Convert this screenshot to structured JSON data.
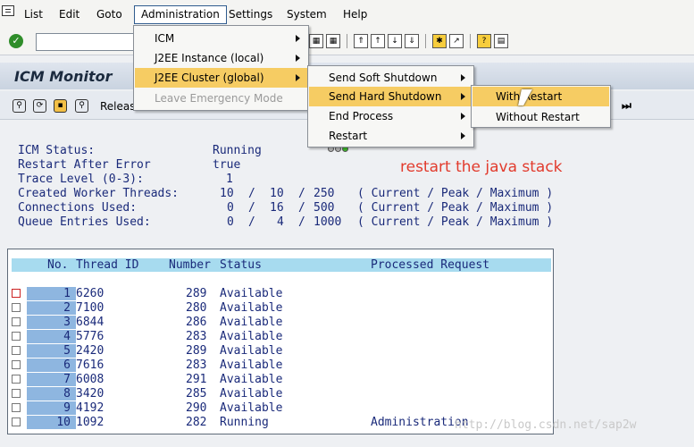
{
  "menubar": {
    "items": [
      "List",
      "Edit",
      "Goto",
      "Administration",
      "Settings",
      "System",
      "Help"
    ]
  },
  "title": "ICM Monitor",
  "apptoolbar": {
    "release_label": "Releas"
  },
  "info": {
    "icm_status": {
      "label": "ICM Status:",
      "value": "Running"
    },
    "restart_after_error": {
      "label": "Restart After Error",
      "value": "true"
    },
    "trace_level": {
      "label": "Trace Level (0-3):",
      "value": "1"
    },
    "created_worker_threads": {
      "label": "Created Worker Threads:",
      "current": "10",
      "peak": "10",
      "maximum": "250",
      "legend": "( Current / Peak / Maximum )"
    },
    "connections_used": {
      "label": "Connections Used:",
      "current": "0",
      "peak": "16",
      "maximum": "500",
      "legend": "( Current / Peak / Maximum )"
    },
    "queue_entries_used": {
      "label": "Queue Entries Used:",
      "current": "0",
      "peak": "4",
      "maximum": "1000",
      "legend": "( Current / Peak / Maximum )"
    }
  },
  "annotation": "restart the java stack",
  "table": {
    "columns": [
      "No.",
      "Thread ID",
      "Number",
      "Status",
      "Processed Request"
    ],
    "rows": [
      {
        "no": "1",
        "thread_id": "6260",
        "number": "289",
        "status": "Available",
        "request": ""
      },
      {
        "no": "2",
        "thread_id": "7100",
        "number": "280",
        "status": "Available",
        "request": ""
      },
      {
        "no": "3",
        "thread_id": "6844",
        "number": "286",
        "status": "Available",
        "request": ""
      },
      {
        "no": "4",
        "thread_id": "5776",
        "number": "283",
        "status": "Available",
        "request": ""
      },
      {
        "no": "5",
        "thread_id": "2420",
        "number": "289",
        "status": "Available",
        "request": ""
      },
      {
        "no": "6",
        "thread_id": "7616",
        "number": "283",
        "status": "Available",
        "request": ""
      },
      {
        "no": "7",
        "thread_id": "6008",
        "number": "291",
        "status": "Available",
        "request": ""
      },
      {
        "no": "8",
        "thread_id": "3420",
        "number": "285",
        "status": "Available",
        "request": ""
      },
      {
        "no": "9",
        "thread_id": "4192",
        "number": "290",
        "status": "Available",
        "request": ""
      },
      {
        "no": "10",
        "thread_id": "1092",
        "number": "282",
        "status": "Running",
        "request": "Administration"
      }
    ]
  },
  "menus": {
    "administration": [
      "ICM",
      "J2EE Instance (local)",
      "J2EE Cluster (global)",
      "Leave Emergency Mode"
    ],
    "cluster": [
      "Send Soft Shutdown",
      "Send Hard Shutdown",
      "End Process",
      "Restart"
    ],
    "hard_shutdown": [
      "With Restart",
      "Without Restart"
    ]
  },
  "watermark": "http://blog.csdn.net/sap2w",
  "colors": {
    "highlight": "#f6cc63",
    "annotation": "#e23b2d",
    "table_header": "#a7dbef",
    "row_number": "#8eb6e0"
  }
}
